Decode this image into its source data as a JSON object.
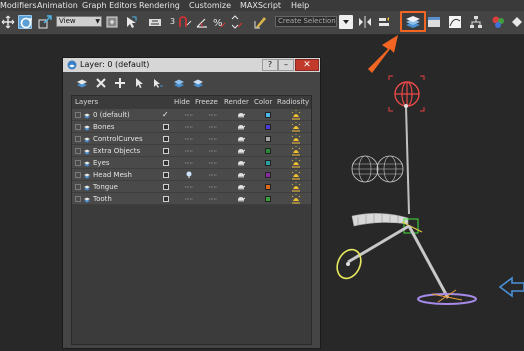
{
  "menubar": {
    "items": [
      "Modifiers",
      "Animation",
      "Graph Editors",
      "Rendering",
      "Customize",
      "MAXScript",
      "Help"
    ]
  },
  "toolbar": {
    "view_dropdown": "View",
    "number_label": "3",
    "selection_set_dropdown": "Create Selection Se",
    "highlighted_button": "manage-layers-button",
    "highlight_color": "#f26522"
  },
  "dialog": {
    "title": "Layer: 0 (default)",
    "help_label": "?",
    "minimize_label": "–",
    "close_label": "✕",
    "columns": [
      "Layers",
      "Hide",
      "Freeze",
      "Render",
      "Color",
      "Radiosity"
    ],
    "layers": [
      {
        "name": "0 (default)",
        "active": true,
        "color": "#4fb7e8"
      },
      {
        "name": "Bones",
        "active": false,
        "color": "#4a3ad8"
      },
      {
        "name": "ControlCurves",
        "active": false,
        "color": "#a8a8a8"
      },
      {
        "name": "Extra Objects",
        "active": false,
        "color": "#2a8a3a"
      },
      {
        "name": "Eyes",
        "active": false,
        "color": "#2aa0a0"
      },
      {
        "name": "Head Mesh",
        "active": false,
        "color": "#8a2aa0",
        "hide_icon": "lightbulb-icon"
      },
      {
        "name": "Tongue",
        "active": false,
        "color": "#d86a1a"
      },
      {
        "name": "Tooth",
        "active": false,
        "color": "#3aa03a"
      }
    ]
  }
}
